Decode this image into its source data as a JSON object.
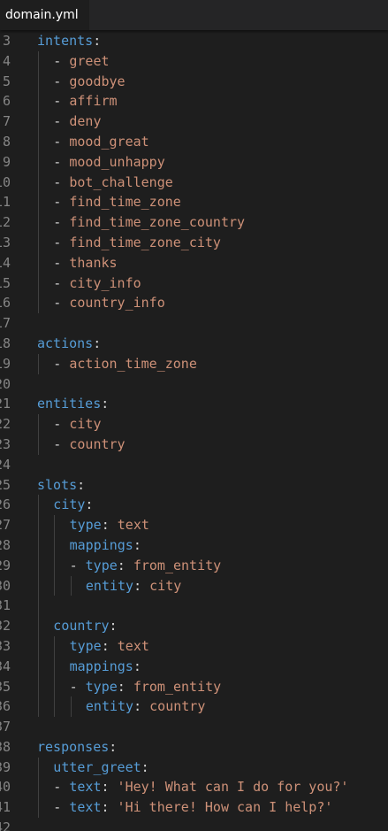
{
  "tab": {
    "filename": "domain.yml"
  },
  "colors": {
    "background": "#1e1e1e",
    "tab_bar": "#252526",
    "line_number": "#858585",
    "key": "#569cd6",
    "punctuation": "#d4d4d4",
    "string_value": "#ce9178",
    "indent_guide": "#404040"
  },
  "lines": [
    {
      "n": "3",
      "indent": 0,
      "guides": [],
      "parts": [
        {
          "t": "intents",
          "c": "key"
        },
        {
          "t": ":",
          "c": "pun"
        }
      ]
    },
    {
      "n": "4",
      "indent": 1,
      "guides": [
        0
      ],
      "parts": [
        {
          "t": "- ",
          "c": "pun"
        },
        {
          "t": "greet",
          "c": "str"
        }
      ]
    },
    {
      "n": "5",
      "indent": 1,
      "guides": [
        0
      ],
      "parts": [
        {
          "t": "- ",
          "c": "pun"
        },
        {
          "t": "goodbye",
          "c": "str"
        }
      ]
    },
    {
      "n": "6",
      "indent": 1,
      "guides": [
        0
      ],
      "parts": [
        {
          "t": "- ",
          "c": "pun"
        },
        {
          "t": "affirm",
          "c": "str"
        }
      ]
    },
    {
      "n": "7",
      "indent": 1,
      "guides": [
        0
      ],
      "parts": [
        {
          "t": "- ",
          "c": "pun"
        },
        {
          "t": "deny",
          "c": "str"
        }
      ]
    },
    {
      "n": "8",
      "indent": 1,
      "guides": [
        0
      ],
      "parts": [
        {
          "t": "- ",
          "c": "pun"
        },
        {
          "t": "mood_great",
          "c": "str"
        }
      ]
    },
    {
      "n": "9",
      "indent": 1,
      "guides": [
        0
      ],
      "parts": [
        {
          "t": "- ",
          "c": "pun"
        },
        {
          "t": "mood_unhappy",
          "c": "str"
        }
      ]
    },
    {
      "n": "10",
      "indent": 1,
      "guides": [
        0
      ],
      "parts": [
        {
          "t": "- ",
          "c": "pun"
        },
        {
          "t": "bot_challenge",
          "c": "str"
        }
      ]
    },
    {
      "n": "11",
      "indent": 1,
      "guides": [
        0
      ],
      "parts": [
        {
          "t": "- ",
          "c": "pun"
        },
        {
          "t": "find_time_zone",
          "c": "str"
        }
      ]
    },
    {
      "n": "12",
      "indent": 1,
      "guides": [
        0
      ],
      "parts": [
        {
          "t": "- ",
          "c": "pun"
        },
        {
          "t": "find_time_zone_country",
          "c": "str"
        }
      ]
    },
    {
      "n": "13",
      "indent": 1,
      "guides": [
        0
      ],
      "parts": [
        {
          "t": "- ",
          "c": "pun"
        },
        {
          "t": "find_time_zone_city",
          "c": "str"
        }
      ]
    },
    {
      "n": "14",
      "indent": 1,
      "guides": [
        0
      ],
      "parts": [
        {
          "t": "- ",
          "c": "pun"
        },
        {
          "t": "thanks",
          "c": "str"
        }
      ]
    },
    {
      "n": "15",
      "indent": 1,
      "guides": [
        0
      ],
      "parts": [
        {
          "t": "- ",
          "c": "pun"
        },
        {
          "t": "city_info",
          "c": "str"
        }
      ]
    },
    {
      "n": "16",
      "indent": 1,
      "guides": [
        0
      ],
      "parts": [
        {
          "t": "- ",
          "c": "pun"
        },
        {
          "t": "country_info",
          "c": "str"
        }
      ]
    },
    {
      "n": "17",
      "indent": 0,
      "guides": [],
      "parts": []
    },
    {
      "n": "18",
      "indent": 0,
      "guides": [],
      "parts": [
        {
          "t": "actions",
          "c": "key"
        },
        {
          "t": ":",
          "c": "pun"
        }
      ]
    },
    {
      "n": "19",
      "indent": 1,
      "guides": [
        0
      ],
      "parts": [
        {
          "t": "- ",
          "c": "pun"
        },
        {
          "t": "action_time_zone",
          "c": "str"
        }
      ]
    },
    {
      "n": "20",
      "indent": 0,
      "guides": [],
      "parts": []
    },
    {
      "n": "21",
      "indent": 0,
      "guides": [],
      "parts": [
        {
          "t": "entities",
          "c": "key"
        },
        {
          "t": ":",
          "c": "pun"
        }
      ]
    },
    {
      "n": "22",
      "indent": 1,
      "guides": [
        0
      ],
      "parts": [
        {
          "t": "- ",
          "c": "pun"
        },
        {
          "t": "city",
          "c": "str"
        }
      ]
    },
    {
      "n": "23",
      "indent": 1,
      "guides": [
        0
      ],
      "parts": [
        {
          "t": "- ",
          "c": "pun"
        },
        {
          "t": "country",
          "c": "str"
        }
      ]
    },
    {
      "n": "24",
      "indent": 0,
      "guides": [],
      "parts": []
    },
    {
      "n": "25",
      "indent": 0,
      "guides": [],
      "parts": [
        {
          "t": "slots",
          "c": "key"
        },
        {
          "t": ":",
          "c": "pun"
        }
      ]
    },
    {
      "n": "26",
      "indent": 1,
      "guides": [
        0
      ],
      "parts": [
        {
          "t": "city",
          "c": "key"
        },
        {
          "t": ":",
          "c": "pun"
        }
      ]
    },
    {
      "n": "27",
      "indent": 2,
      "guides": [
        0,
        1
      ],
      "parts": [
        {
          "t": "type",
          "c": "key"
        },
        {
          "t": ": ",
          "c": "pun"
        },
        {
          "t": "text",
          "c": "str"
        }
      ]
    },
    {
      "n": "28",
      "indent": 2,
      "guides": [
        0,
        1
      ],
      "parts": [
        {
          "t": "mappings",
          "c": "key"
        },
        {
          "t": ":",
          "c": "pun"
        }
      ]
    },
    {
      "n": "29",
      "indent": 2,
      "guides": [
        0,
        1
      ],
      "parts": [
        {
          "t": "- ",
          "c": "pun"
        },
        {
          "t": "type",
          "c": "key"
        },
        {
          "t": ": ",
          "c": "pun"
        },
        {
          "t": "from_entity",
          "c": "str"
        }
      ]
    },
    {
      "n": "30",
      "indent": 3,
      "guides": [
        0,
        1,
        2
      ],
      "parts": [
        {
          "t": "entity",
          "c": "key"
        },
        {
          "t": ": ",
          "c": "pun"
        },
        {
          "t": "city",
          "c": "str"
        }
      ]
    },
    {
      "n": "31",
      "indent": 0,
      "guides": [
        0
      ],
      "parts": []
    },
    {
      "n": "32",
      "indent": 1,
      "guides": [
        0
      ],
      "parts": [
        {
          "t": "country",
          "c": "key"
        },
        {
          "t": ":",
          "c": "pun"
        }
      ]
    },
    {
      "n": "33",
      "indent": 2,
      "guides": [
        0,
        1
      ],
      "parts": [
        {
          "t": "type",
          "c": "key"
        },
        {
          "t": ": ",
          "c": "pun"
        },
        {
          "t": "text",
          "c": "str"
        }
      ]
    },
    {
      "n": "34",
      "indent": 2,
      "guides": [
        0,
        1
      ],
      "parts": [
        {
          "t": "mappings",
          "c": "key"
        },
        {
          "t": ":",
          "c": "pun"
        }
      ]
    },
    {
      "n": "35",
      "indent": 2,
      "guides": [
        0,
        1
      ],
      "parts": [
        {
          "t": "- ",
          "c": "pun"
        },
        {
          "t": "type",
          "c": "key"
        },
        {
          "t": ": ",
          "c": "pun"
        },
        {
          "t": "from_entity",
          "c": "str"
        }
      ]
    },
    {
      "n": "36",
      "indent": 3,
      "guides": [
        0,
        1,
        2
      ],
      "parts": [
        {
          "t": "entity",
          "c": "key"
        },
        {
          "t": ": ",
          "c": "pun"
        },
        {
          "t": "country",
          "c": "str"
        }
      ]
    },
    {
      "n": "37",
      "indent": 0,
      "guides": [],
      "parts": []
    },
    {
      "n": "38",
      "indent": 0,
      "guides": [],
      "parts": [
        {
          "t": "responses",
          "c": "key"
        },
        {
          "t": ":",
          "c": "pun"
        }
      ]
    },
    {
      "n": "39",
      "indent": 1,
      "guides": [
        0
      ],
      "parts": [
        {
          "t": "utter_greet",
          "c": "key"
        },
        {
          "t": ":",
          "c": "pun"
        }
      ]
    },
    {
      "n": "40",
      "indent": 1,
      "guides": [
        0
      ],
      "parts": [
        {
          "t": "- ",
          "c": "pun"
        },
        {
          "t": "text",
          "c": "key"
        },
        {
          "t": ": ",
          "c": "pun"
        },
        {
          "t": "'Hey! What can I do for you?'",
          "c": "str"
        }
      ]
    },
    {
      "n": "41",
      "indent": 1,
      "guides": [
        0
      ],
      "parts": [
        {
          "t": "- ",
          "c": "pun"
        },
        {
          "t": "text",
          "c": "key"
        },
        {
          "t": ": ",
          "c": "pun"
        },
        {
          "t": "'Hi there! How can I help?'",
          "c": "str"
        }
      ]
    },
    {
      "n": "42",
      "indent": 0,
      "guides": [],
      "parts": []
    }
  ]
}
